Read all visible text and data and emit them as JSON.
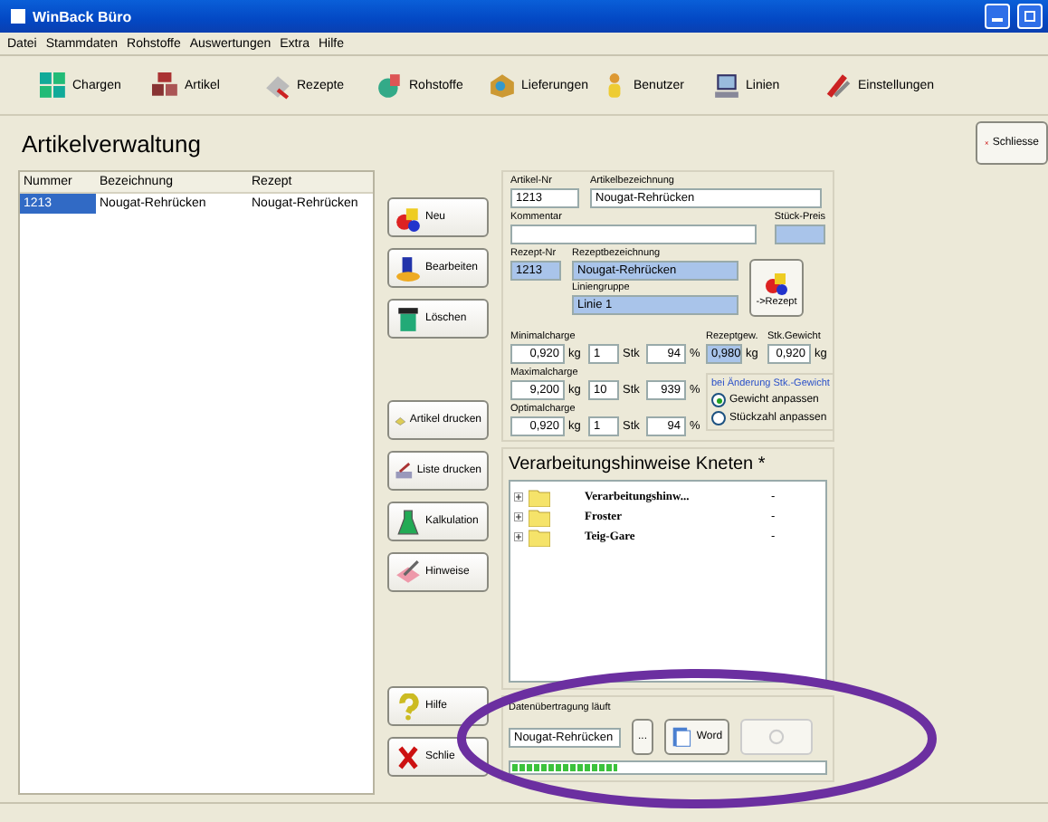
{
  "window": {
    "title": "WinBack Büro"
  },
  "menu": [
    "Datei",
    "Stammdaten",
    "Rohstoffe",
    "Auswertungen",
    "Extra",
    "Hilfe"
  ],
  "toolbar": [
    "Chargen",
    "Artikel",
    "Rezepte",
    "Rohstoffe",
    "Lieferungen",
    "Benutzer",
    "Linien",
    "Einstellungen"
  ],
  "page": {
    "title": "Artikelverwaltung",
    "close_button": "Schliesse"
  },
  "article_list": {
    "columns": [
      "Nummer",
      "Bezeichnung",
      "Rezept"
    ],
    "rows": [
      {
        "cells": [
          "1213",
          "Nougat-Rehrücken",
          "Nougat-Rehrücken"
        ],
        "selected": true
      }
    ]
  },
  "actions": [
    [
      "Neu",
      "Bearbeiten",
      "Löschen"
    ],
    [
      "Artikel drucken",
      "Liste drucken",
      "Kalkulation",
      "Hinweise"
    ],
    [
      "Hilfe",
      "Schlie"
    ]
  ],
  "form": {
    "article_no": {
      "label": "Artikel-Nr",
      "value": "1213"
    },
    "article_name": {
      "label": "Artikelbezeichnung",
      "value": "Nougat-Rehrücken"
    },
    "comment": {
      "label": "Kommentar"
    },
    "unit_price": {
      "label": "Stück-Preis"
    },
    "recipe_no": {
      "label": "Rezept-Nr",
      "value": "1213"
    },
    "recipe_name": {
      "label": "Rezeptbezeichnung",
      "value": "Nougat-Rehrücken"
    },
    "line_group": {
      "label": "Liniengruppe",
      "value": "Linie 1"
    },
    "recipe_button": "->Rezept",
    "charges": [
      {
        "label": "Minimalcharge",
        "kg": "0,920",
        "kg_unit": "kg",
        "pieces": "1",
        "pieces_unit": "Stk",
        "percent": "94",
        "percent_unit": "%"
      },
      {
        "label": "Maximalcharge",
        "kg": "9,200",
        "kg_unit": "kg",
        "pieces": "10",
        "pieces_unit": "Stk",
        "percent": "939",
        "percent_unit": "%"
      },
      {
        "label": "Optimalcharge",
        "kg": "0,920",
        "kg_unit": "kg",
        "pieces": "1",
        "pieces_unit": "Stk",
        "percent": "94",
        "percent_unit": "%"
      }
    ],
    "recipe_weight": {
      "label": "Rezeptgew.",
      "value": "0,980",
      "unit": "kg"
    },
    "piece_weight": {
      "label": "Stk.Gewicht",
      "value": "0,920",
      "unit": "kg"
    },
    "on_change": {
      "title": "bei Änderung Stk.-Gewicht",
      "options": [
        {
          "label": "Gewicht anpassen",
          "selected": true
        },
        {
          "label": "Stückzahl anpassen",
          "selected": false
        }
      ]
    }
  },
  "notes": {
    "title": "Verarbeitungshinweise Kneten *",
    "items": [
      {
        "label": "Verarbeitungshinw...",
        "value": "-"
      },
      {
        "label": "Froster",
        "value": "-"
      },
      {
        "label": "Teig-Gare",
        "value": "-"
      }
    ]
  },
  "transfer": {
    "label": "Datenübertragung läuft",
    "value": "Nougat-Rehrücken",
    "browse": "...",
    "word_button": "Word",
    "progress": {
      "level": 0.34
    }
  }
}
